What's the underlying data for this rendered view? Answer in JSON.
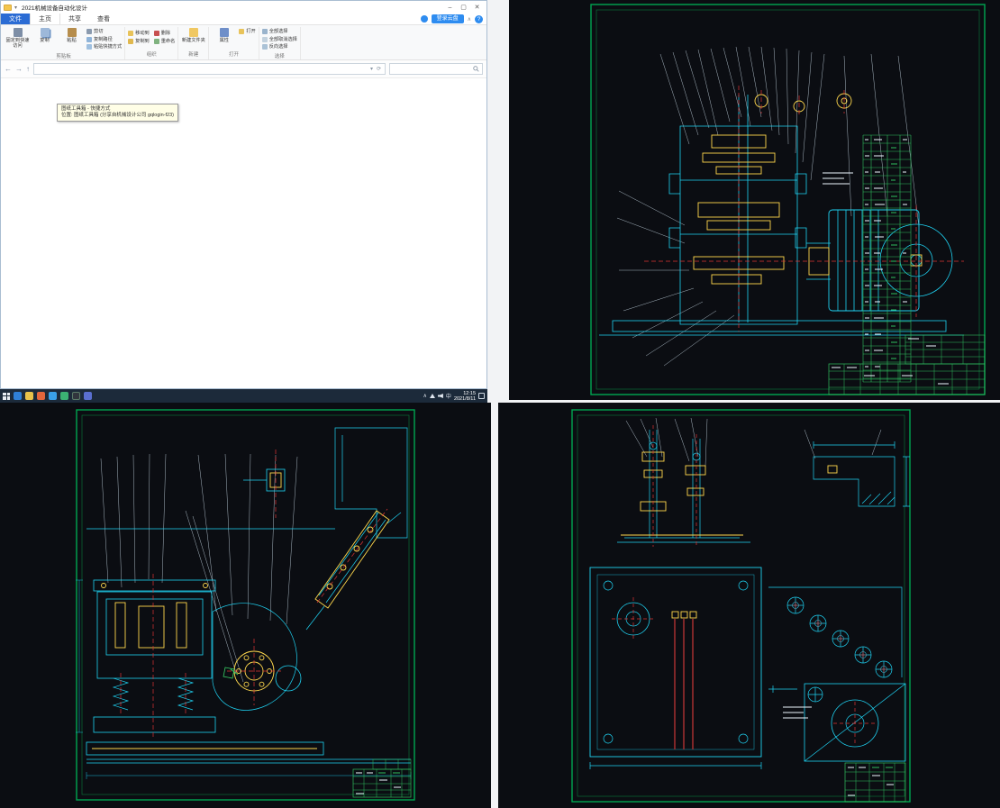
{
  "explorer": {
    "title": "2021机械设备自动化设计",
    "controls": {
      "minimize": "–",
      "maximize": "▢",
      "close": "✕"
    },
    "tabs": [
      "文件",
      "主页",
      "共享",
      "查看"
    ],
    "cloud_button": "登录云盘",
    "help_button": "?",
    "ribbon_collapse": "∧",
    "ribbon": {
      "groups": [
        {
          "label": "剪贴板",
          "large": [
            "固定到快速访问",
            "复制",
            "粘贴"
          ],
          "small": [
            "剪切",
            "复制路径",
            "粘贴快捷方式"
          ]
        },
        {
          "label": "组织",
          "small": [
            "移动到",
            "复制到",
            "删除",
            "重命名"
          ]
        },
        {
          "label": "新建",
          "large": [
            "新建文件夹"
          ]
        },
        {
          "label": "打开",
          "large": [
            "属性"
          ],
          "small": [
            "打开"
          ]
        },
        {
          "label": "选择",
          "small": [
            "全部选择",
            "全部取消选择",
            "反向选择"
          ]
        }
      ]
    },
    "nav": {
      "back": "←",
      "forward": "→",
      "up": "↑",
      "dropdown": "▾",
      "refresh": "⟳",
      "address_value": "",
      "search_placeholder": ""
    },
    "tooltip": {
      "line1": "图纸工具箱 - 快捷方式",
      "line2": "位置: 图纸工具箱 (分享自机械设计公司 gqlogin-f23)"
    }
  },
  "taskbar": {
    "time": "12:15",
    "date": "2021/8/11",
    "ime": "中",
    "tray_chevron": "∧",
    "apps": [
      "edge",
      "file-explorer",
      "firefox",
      "chrome",
      "wechat",
      "cad",
      "qq"
    ]
  },
  "cad": {
    "colors": {
      "background": "#0b0d12",
      "frame": "#00a651",
      "outline": "#1fd2f2",
      "detail": "#ffd84d",
      "centerline": "#e03434",
      "text": "#eef6ff",
      "table": "#2fbf5f"
    },
    "sheets": [
      {
        "position": "top-right"
      },
      {
        "position": "bottom-left"
      },
      {
        "position": "bottom-right"
      }
    ]
  }
}
